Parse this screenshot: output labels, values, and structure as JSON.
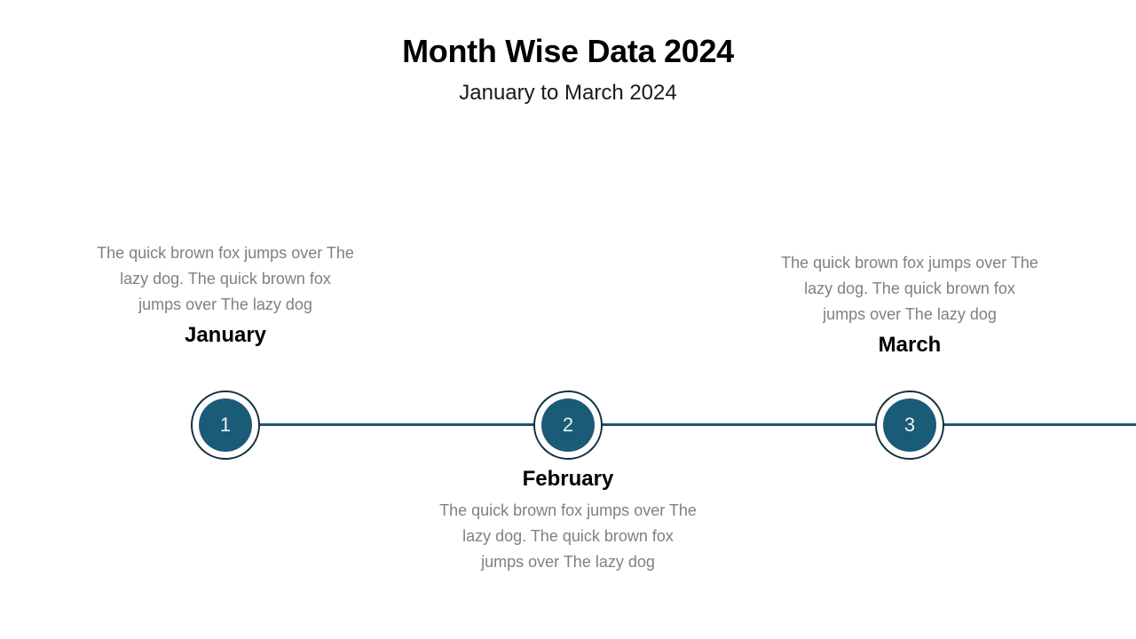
{
  "header": {
    "title": "Month Wise Data 2024",
    "subtitle": "January to March 2024"
  },
  "colors": {
    "background": "#ffffff",
    "marker_fill": "#1a5b77",
    "marker_ring": "#12323f",
    "axis_line": "#1d5470",
    "body_text": "#808080",
    "label_text": "#000000",
    "number_text": "#eaf2f5"
  },
  "timeline": {
    "items": [
      {
        "number": "1",
        "label": "January",
        "body": "The quick brown fox jumps over The lazy dog. The quick brown fox jumps over The lazy dog",
        "position": "above"
      },
      {
        "number": "2",
        "label": "February",
        "body": "The quick brown fox jumps over The lazy dog. The quick brown fox jumps over The lazy dog",
        "position": "below"
      },
      {
        "number": "3",
        "label": "March",
        "body": "The quick brown fox jumps over The lazy dog. The quick brown fox jumps over The lazy dog",
        "position": "above"
      }
    ]
  }
}
